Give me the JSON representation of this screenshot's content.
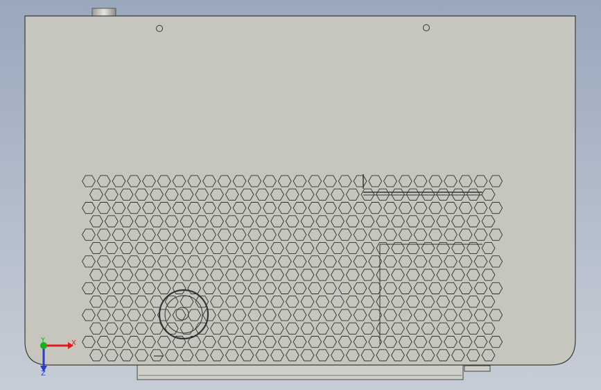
{
  "scene": {
    "view": "front",
    "background_top": "#9aa8bd",
    "background_bottom": "#c7cdd6",
    "part_color": "#c6c6be",
    "edge_color": "#3a3a3a"
  },
  "triad": {
    "x_label": "X",
    "y_label": "Y",
    "z_label": "Z",
    "x_color": "#e01a1a",
    "y_color": "#18b018",
    "z_color": "#2a3cc8"
  }
}
